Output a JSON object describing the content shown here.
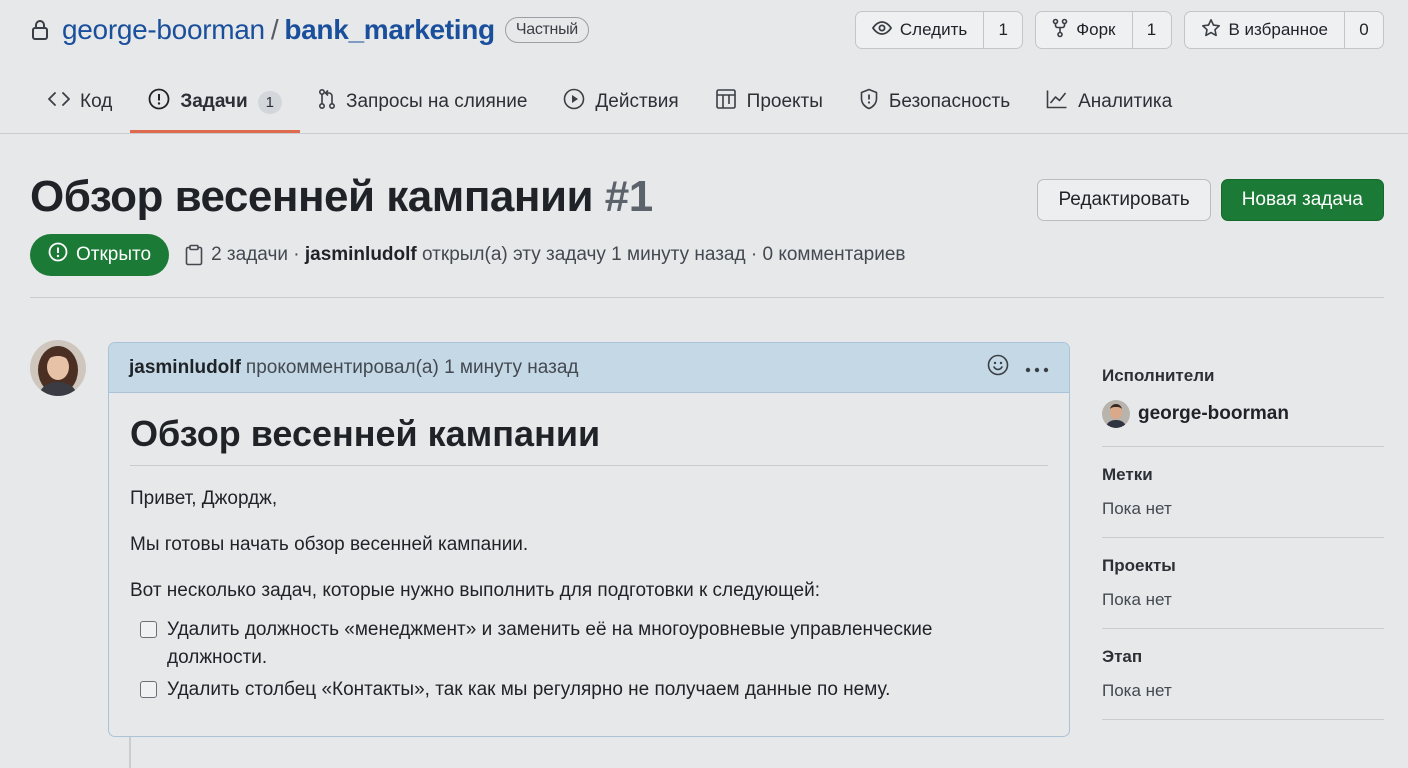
{
  "repo": {
    "owner": "george-boorman",
    "separator": "/",
    "name": "bank_marketing",
    "visibility": "Частный"
  },
  "actions": {
    "watch": {
      "label": "Следить",
      "count": "1"
    },
    "fork": {
      "label": "Форк",
      "count": "1"
    },
    "star": {
      "label": "В избранное",
      "count": "0"
    }
  },
  "tabs": [
    {
      "label": "Код",
      "icon": "code-icon"
    },
    {
      "label": "Задачи",
      "icon": "issue-icon",
      "counter": "1",
      "active": true
    },
    {
      "label": "Запросы на слияние",
      "icon": "pull-request-icon"
    },
    {
      "label": "Действия",
      "icon": "play-icon"
    },
    {
      "label": "Проекты",
      "icon": "table-icon"
    },
    {
      "label": "Безопасность",
      "icon": "shield-icon"
    },
    {
      "label": "Аналитика",
      "icon": "graph-icon"
    }
  ],
  "issue": {
    "title": "Обзор весенней кампании",
    "number": "#1",
    "edit_label": "Редактировать",
    "new_label": "Новая задача",
    "state": "Открыто",
    "tasks_count": "2 задачи",
    "dot1": "·",
    "author": "jasminludolf",
    "opened_text": "открыл(а) эту задачу 1 минуту назад",
    "dot2": "·",
    "comments": "0 комментариев"
  },
  "comment": {
    "author": "jasminludolf",
    "action_text": "прокомментировал(а) 1 минуту назад",
    "heading": "Обзор весенней кампании",
    "greeting": "Привет, Джордж,",
    "line1": "Мы готовы начать обзор весенней кампании.",
    "line2": "Вот несколько задач, которые нужно выполнить для подготовки к следующей:",
    "tasks": [
      {
        "text": "Удалить должность «менеджмент» и заменить её на многоуровневые управленческие должности.",
        "checked": false
      },
      {
        "text": "Удалить столбец «Контакты», так как мы регулярно не получаем данные по нему.",
        "checked": false
      }
    ]
  },
  "sidebar": {
    "assignees_title": "Исполнители",
    "assignee": "george-boorman",
    "labels_title": "Метки",
    "labels_value": "Пока нет",
    "projects_title": "Проекты",
    "projects_value": "Пока нет",
    "milestone_title": "Этап",
    "milestone_value": "Пока нет"
  },
  "colors": {
    "primary_green": "#1b7a36",
    "link_blue": "#1a4f9c",
    "active_tab_underline": "#e06a4e",
    "comment_header": "#c5d8e6"
  }
}
